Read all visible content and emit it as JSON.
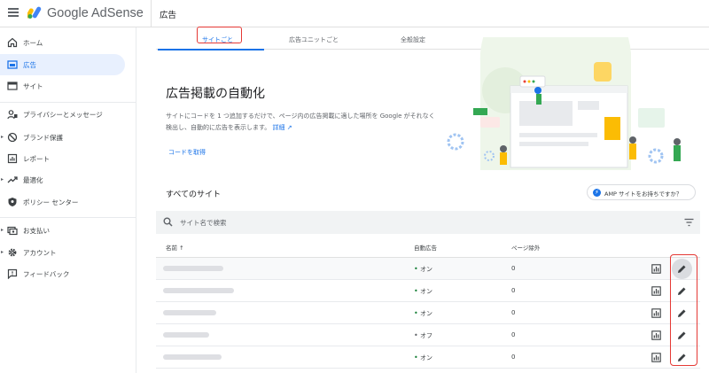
{
  "app": {
    "name": "Google AdSense",
    "page_title": "広告"
  },
  "sidebar": {
    "items": [
      {
        "label": "ホーム",
        "icon": "home-icon"
      },
      {
        "label": "広告",
        "icon": "ads-icon",
        "active": true
      },
      {
        "label": "サイト",
        "icon": "sites-icon"
      },
      {
        "label": "プライバシーとメッセージ",
        "icon": "privacy-icon"
      },
      {
        "label": "ブランド保護",
        "icon": "block-icon",
        "expandable": true
      },
      {
        "label": "レポート",
        "icon": "reports-icon"
      },
      {
        "label": "最適化",
        "icon": "trending-icon",
        "expandable": true
      },
      {
        "label": "ポリシー センター",
        "icon": "policy-shield-icon"
      },
      {
        "label": "お支払い",
        "icon": "payments-icon",
        "expandable": true
      },
      {
        "label": "アカウント",
        "icon": "gear-icon",
        "expandable": true
      },
      {
        "label": "フィードバック",
        "icon": "feedback-icon"
      }
    ]
  },
  "tabs": [
    {
      "label": "サイトごと",
      "active": true
    },
    {
      "label": "広告ユニットごと"
    },
    {
      "label": "全般設定"
    }
  ],
  "hero": {
    "title": "広告掲載の自動化",
    "description": "サイトにコードを 1 つ追加するだけで、ページ内の広告掲載に適した場所を Google がそれなく検出し、自動的に広告を表示します。",
    "details_link": "詳細",
    "get_code": "コードを取得"
  },
  "sites": {
    "title": "すべてのサイト",
    "amp_button": "AMP サイトをお持ちですか？",
    "search_placeholder": "サイト名で検索",
    "columns": {
      "name": "名前 ↑",
      "auto_ads": "自動広告",
      "excluded_pages": "ページ除外"
    },
    "rows": [
      {
        "status": "オン",
        "on": true,
        "excluded": "0"
      },
      {
        "status": "オン",
        "on": true,
        "excluded": "0"
      },
      {
        "status": "オン",
        "on": true,
        "excluded": "0"
      },
      {
        "status": "オフ",
        "on": false,
        "excluded": "0"
      },
      {
        "status": "オン",
        "on": true,
        "excluded": "0"
      }
    ]
  },
  "colors": {
    "accent": "#1a73e8",
    "on": "#188038",
    "highlight": "#e53935"
  }
}
